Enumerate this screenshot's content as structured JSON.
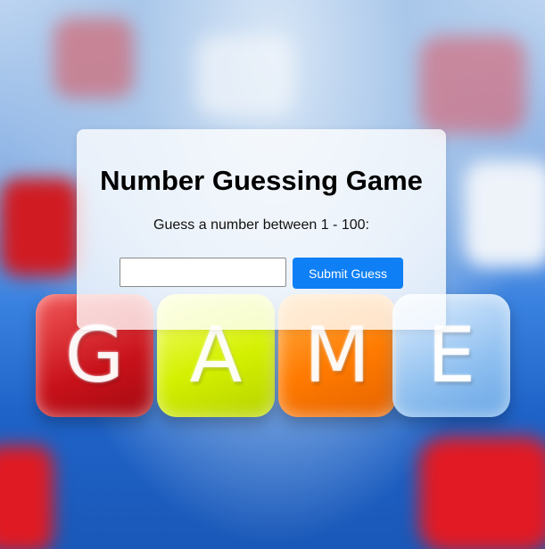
{
  "game": {
    "title": "Number Guessing Game",
    "prompt": "Guess a number between 1 - 100:",
    "input": {
      "value": "",
      "placeholder": ""
    },
    "submit_label": "Submit Guess"
  },
  "background": {
    "dice_letters": [
      "G",
      "A",
      "M",
      "E"
    ]
  },
  "colors": {
    "accent": "#0f7ff5",
    "card": "#ffffffc7"
  }
}
